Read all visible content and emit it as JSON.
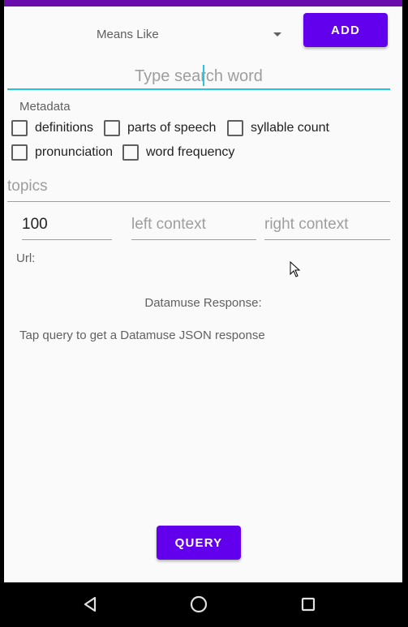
{
  "app": {
    "colors": {
      "accent": "#6200ee",
      "input_focus": "#26c6da",
      "top_strip": "#6a0dad"
    }
  },
  "toolbar": {
    "spinner_value": "Means Like",
    "add_label": "ADD"
  },
  "search": {
    "placeholder": "Type search word",
    "value": ""
  },
  "metadata": {
    "label": "Metadata",
    "options": [
      {
        "label": "definitions",
        "checked": false
      },
      {
        "label": "parts of speech",
        "checked": false
      },
      {
        "label": "syllable count",
        "checked": false
      },
      {
        "label": "pronunciation",
        "checked": false
      },
      {
        "label": "word frequency",
        "checked": false
      }
    ]
  },
  "topics": {
    "placeholder": "topics",
    "value": ""
  },
  "context": {
    "max_value": "100",
    "left_placeholder": "left context",
    "right_placeholder": "right context"
  },
  "url": {
    "label": "Url:"
  },
  "response": {
    "title": "Datamuse Response:",
    "text": "Tap query to get a Datamuse JSON response"
  },
  "footer": {
    "query_label": "QUERY"
  },
  "icons": {
    "spinner": "chevron-down-icon",
    "back": "back-triangle-icon",
    "home": "home-circle-icon",
    "recents": "recents-square-icon",
    "cursor": "mouse-pointer-icon"
  }
}
